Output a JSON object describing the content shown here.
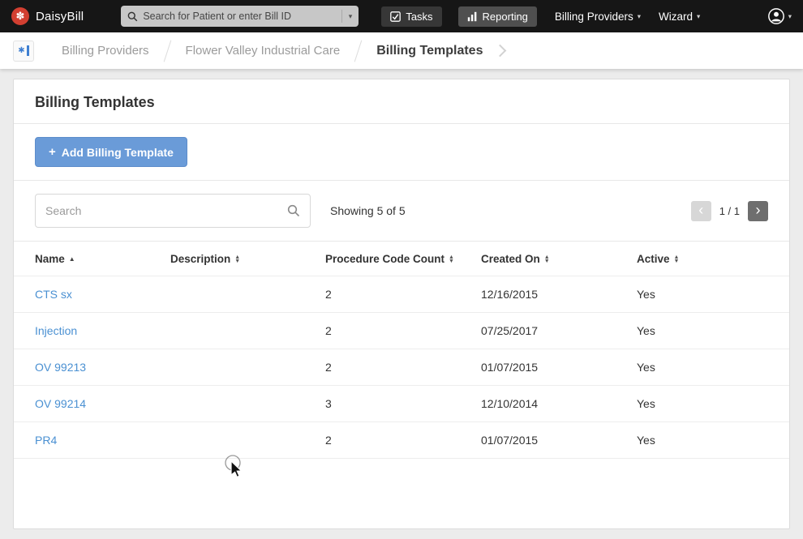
{
  "topbar": {
    "brand": "DaisyBill",
    "search_placeholder": "Search for Patient or enter Bill ID",
    "tasks_label": "Tasks",
    "reporting_label": "Reporting",
    "billing_providers_label": "Billing Providers",
    "wizard_label": "Wizard"
  },
  "breadcrumb": {
    "items": [
      "Billing Providers",
      "Flower Valley Industrial Care",
      "Billing Templates"
    ]
  },
  "page": {
    "title": "Billing Templates",
    "add_button_label": "Add Billing Template",
    "search_placeholder": "Search",
    "showing": "Showing 5 of 5",
    "pagination": {
      "label": "1 / 1",
      "prev": "‹",
      "next": "›"
    }
  },
  "table": {
    "columns": [
      {
        "label": "Name",
        "sort": "asc"
      },
      {
        "label": "Description",
        "sort": "both"
      },
      {
        "label": "Procedure Code Count",
        "sort": "both"
      },
      {
        "label": "Created On",
        "sort": "both"
      },
      {
        "label": "Active",
        "sort": "both"
      }
    ],
    "rows": [
      {
        "name": "CTS sx",
        "description": "",
        "count": "2",
        "created": "12/16/2015",
        "active": "Yes"
      },
      {
        "name": "Injection",
        "description": "",
        "count": "2",
        "created": "07/25/2017",
        "active": "Yes"
      },
      {
        "name": "OV 99213",
        "description": "",
        "count": "2",
        "created": "01/07/2015",
        "active": "Yes"
      },
      {
        "name": "OV 99214",
        "description": "",
        "count": "3",
        "created": "12/10/2014",
        "active": "Yes"
      },
      {
        "name": "PR4",
        "description": "",
        "count": "2",
        "created": "01/07/2015",
        "active": "Yes"
      }
    ]
  },
  "icons": {
    "daisy": "✽",
    "plus": "+",
    "caret_down": "▾",
    "sort_up": "▲",
    "sort_down": "▼",
    "sort_asc": "▲",
    "star": "✱"
  },
  "colors": {
    "topbar_bg": "#161616",
    "logo_red": "#d23f31",
    "accent_blue": "#6a9bd8",
    "link_blue": "#4a90d2"
  }
}
